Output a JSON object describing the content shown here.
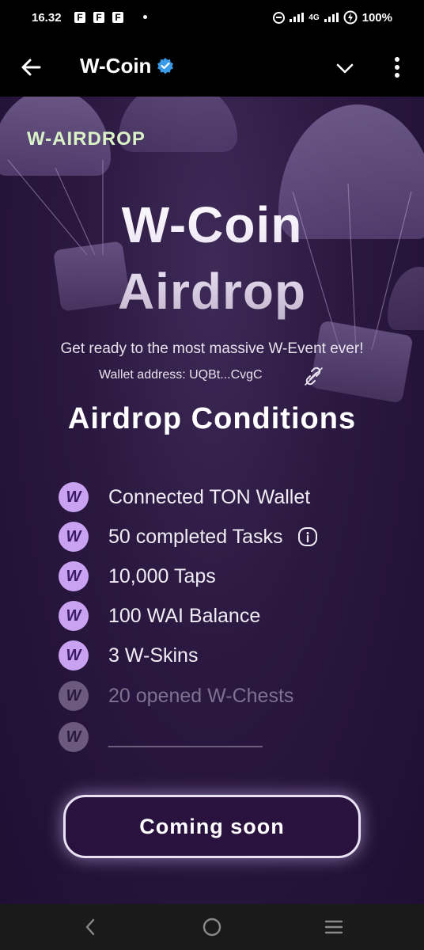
{
  "status_bar": {
    "time": "16.32",
    "notification_icons": [
      "F",
      "F",
      "F"
    ],
    "network": "4G",
    "battery": "100%"
  },
  "app_bar": {
    "title": "W-Coin",
    "back_icon": "arrow-left",
    "verified_icon": "verified-badge",
    "menu_icon": "chevron-down",
    "more_icon": "kebab-vertical"
  },
  "page": {
    "brand": "W-AIRDROP",
    "hero_line1": "W-Coin",
    "hero_line2": "Airdrop",
    "subtitle": "Get ready to the most massive W-Event ever!",
    "wallet_text": "Wallet address: UQBt...CvgC",
    "conditions_title": "Airdrop Conditions",
    "conditions": [
      {
        "label": "Connected TON Wallet",
        "done": true
      },
      {
        "label": "50 completed Tasks",
        "done": true,
        "info": true
      },
      {
        "label": "10,000 Taps",
        "done": true
      },
      {
        "label": "100 WAI Balance",
        "done": true
      },
      {
        "label": "3 W-Skins",
        "done": true
      },
      {
        "label": "20 opened W-Chests",
        "done": false
      },
      {
        "label": "______________",
        "done": false
      }
    ],
    "cta": "Coming soon"
  },
  "colors": {
    "accent": "#c9a3f2",
    "brand_text": "#d9f2c6",
    "background": "#2a1840"
  }
}
